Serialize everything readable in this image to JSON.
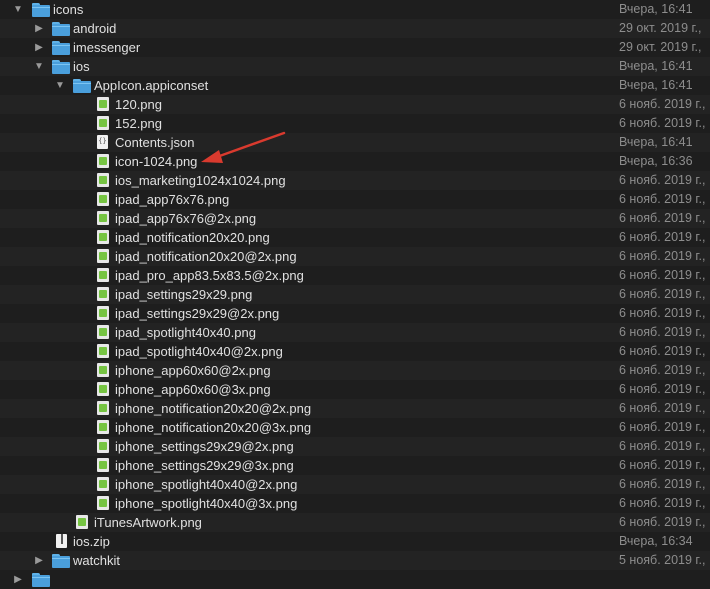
{
  "rows": [
    {
      "name": "icons",
      "date": "Вчера, 16:41"
    },
    {
      "name": "android",
      "date": "29 окт. 2019 г.,"
    },
    {
      "name": "imessenger",
      "date": "29 окт. 2019 г.,"
    },
    {
      "name": "ios",
      "date": "Вчера, 16:41"
    },
    {
      "name": "AppIcon.appiconset",
      "date": "Вчера, 16:41"
    },
    {
      "name": "120.png",
      "date": "6 нояб. 2019 г.,"
    },
    {
      "name": "152.png",
      "date": "6 нояб. 2019 г.,"
    },
    {
      "name": "Contents.json",
      "date": "Вчера, 16:41"
    },
    {
      "name": "icon-1024.png",
      "date": "Вчера, 16:36"
    },
    {
      "name": "ios_marketing1024x1024.png",
      "date": "6 нояб. 2019 г.,"
    },
    {
      "name": "ipad_app76x76.png",
      "date": "6 нояб. 2019 г.,"
    },
    {
      "name": "ipad_app76x76@2x.png",
      "date": "6 нояб. 2019 г.,"
    },
    {
      "name": "ipad_notification20x20.png",
      "date": "6 нояб. 2019 г.,"
    },
    {
      "name": "ipad_notification20x20@2x.png",
      "date": "6 нояб. 2019 г.,"
    },
    {
      "name": "ipad_pro_app83.5x83.5@2x.png",
      "date": "6 нояб. 2019 г.,"
    },
    {
      "name": "ipad_settings29x29.png",
      "date": "6 нояб. 2019 г.,"
    },
    {
      "name": "ipad_settings29x29@2x.png",
      "date": "6 нояб. 2019 г.,"
    },
    {
      "name": "ipad_spotlight40x40.png",
      "date": "6 нояб. 2019 г.,"
    },
    {
      "name": "ipad_spotlight40x40@2x.png",
      "date": "6 нояб. 2019 г.,"
    },
    {
      "name": "iphone_app60x60@2x.png",
      "date": "6 нояб. 2019 г.,"
    },
    {
      "name": "iphone_app60x60@3x.png",
      "date": "6 нояб. 2019 г.,"
    },
    {
      "name": "iphone_notification20x20@2x.png",
      "date": "6 нояб. 2019 г.,"
    },
    {
      "name": "iphone_notification20x20@3x.png",
      "date": "6 нояб. 2019 г.,"
    },
    {
      "name": "iphone_settings29x29@2x.png",
      "date": "6 нояб. 2019 г.,"
    },
    {
      "name": "iphone_settings29x29@3x.png",
      "date": "6 нояб. 2019 г.,"
    },
    {
      "name": "iphone_spotlight40x40@2x.png",
      "date": "6 нояб. 2019 г.,"
    },
    {
      "name": "iphone_spotlight40x40@3x.png",
      "date": "6 нояб. 2019 г.,"
    },
    {
      "name": "iTunesArtwork.png",
      "date": "6 нояб. 2019 г.,"
    },
    {
      "name": "ios.zip",
      "date": "Вчера, 16:34"
    },
    {
      "name": "watchkit",
      "date": "5 нояб. 2019 г.,"
    }
  ],
  "annotation": {
    "icon": "arrow-annotation-icon",
    "color": "#d93a2e"
  },
  "colors": {
    "background": "#1e1e1e",
    "folder": "#4a9fdc",
    "png_badge": "#76c442",
    "date_text": "#8d8d8d"
  }
}
